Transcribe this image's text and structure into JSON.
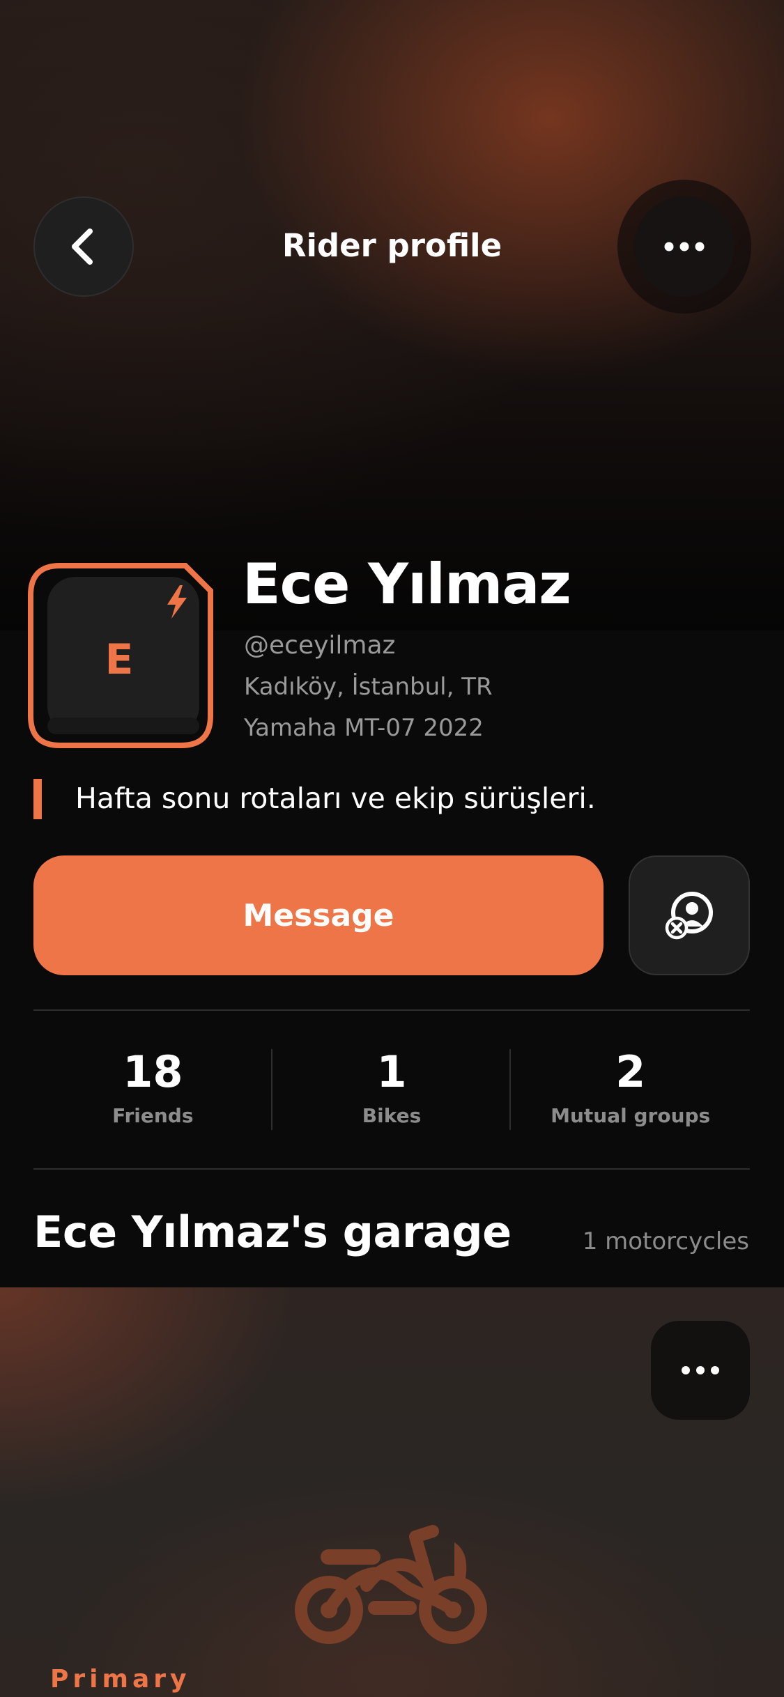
{
  "header": {
    "title": "Rider profile",
    "back_icon": "chevron-left-icon",
    "more_icon": "more-horizontal-icon"
  },
  "profile": {
    "initial": "E",
    "name": "Ece Yılmaz",
    "handle": "@eceyilmaz",
    "location": "Kadıköy, İstanbul, TR",
    "bike": "Yamaha MT-07 2022",
    "bio": "Hafta sonu rotaları ve ekip sürüşleri.",
    "badge_icon": "lightning-icon"
  },
  "actions": {
    "message_label": "Message",
    "friend_icon": "remove-friend-icon"
  },
  "stats": [
    {
      "value": "18",
      "label": "Friends"
    },
    {
      "value": "1",
      "label": "Bikes"
    },
    {
      "value": "2",
      "label": "Mutual groups"
    }
  ],
  "garage": {
    "title": "Ece Yılmaz's garage",
    "count": "1 motorcycles",
    "card": {
      "tag": "Primary",
      "more_icon": "more-horizontal-icon",
      "image_icon": "motorcycle-icon"
    }
  },
  "colors": {
    "accent": "#ee7547",
    "background": "#0a0a0a",
    "surface": "#1f1f20",
    "muted_text": "#9a9a9a"
  }
}
